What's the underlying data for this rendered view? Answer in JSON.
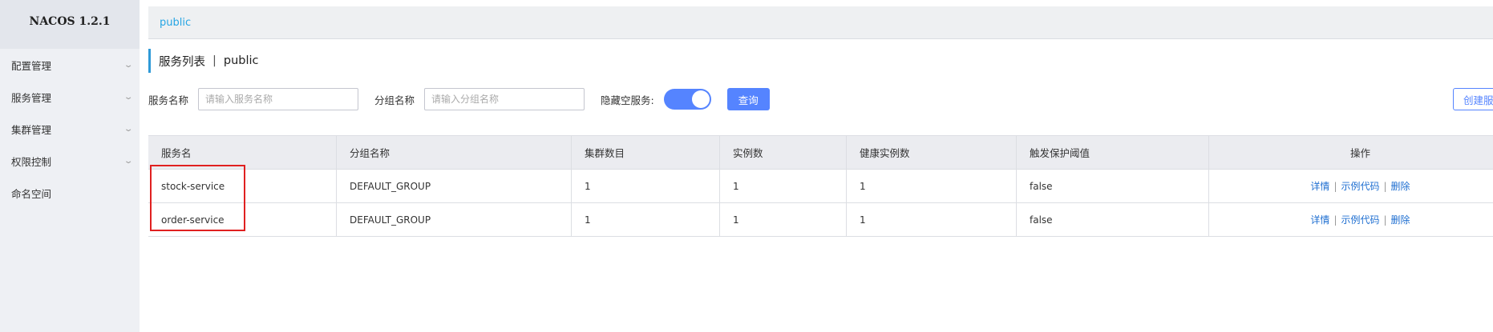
{
  "app": {
    "logo": "NACOS 1.2.1"
  },
  "sidebar": {
    "items": [
      {
        "label": "配置管理",
        "expandable": true
      },
      {
        "label": "服务管理",
        "expandable": true
      },
      {
        "label": "集群管理",
        "expandable": true
      },
      {
        "label": "权限控制",
        "expandable": true
      },
      {
        "label": "命名空间",
        "expandable": false
      }
    ]
  },
  "breadcrumb": {
    "namespace": "public"
  },
  "page": {
    "title": "服务列表",
    "separator": "|",
    "namespace": "public"
  },
  "filters": {
    "service_name_label": "服务名称",
    "service_name_placeholder": "请输入服务名称",
    "group_name_label": "分组名称",
    "group_name_placeholder": "请输入分组名称",
    "hide_empty_label": "隐藏空服务:",
    "hide_empty_on": true,
    "query_button": "查询",
    "create_button": "创建服务"
  },
  "table": {
    "columns": [
      "服务名",
      "分组名称",
      "集群数目",
      "实例数",
      "健康实例数",
      "触发保护阈值",
      "操作"
    ],
    "rows": [
      {
        "service": "stock-service",
        "group": "DEFAULT_GROUP",
        "clusters": "1",
        "instances": "1",
        "healthy": "1",
        "threshold": "false"
      },
      {
        "service": "order-service",
        "group": "DEFAULT_GROUP",
        "clusters": "1",
        "instances": "1",
        "healthy": "1",
        "threshold": "false"
      }
    ],
    "actions": {
      "detail": "详情",
      "sample_code": "示例代码",
      "delete": "删除",
      "separator": "|"
    }
  },
  "colors": {
    "accent": "#5584ff",
    "link": "#1f6fd1",
    "breadcrumb": "#26a5e4",
    "highlight": "#e02020"
  }
}
